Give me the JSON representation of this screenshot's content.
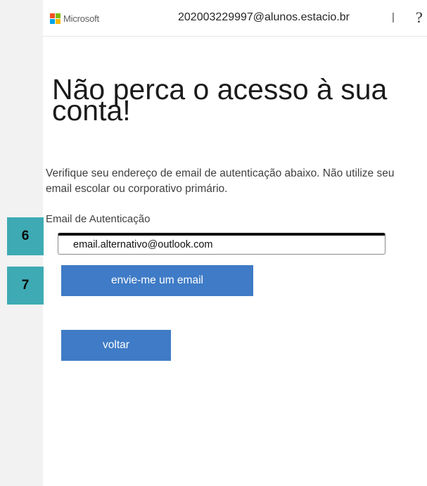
{
  "brand": {
    "name": "Microsoft",
    "colors": [
      "#f25022",
      "#7fba00",
      "#00a4ef",
      "#ffb900"
    ]
  },
  "header": {
    "account_email": "202003229997@alunos.estacio.br",
    "separator": "|",
    "help_symbol": "?"
  },
  "main": {
    "title": "Não perca o acesso à sua conta!",
    "description": "Verifique seu endereço de email de autenticação abaixo. Não utilize seu email escolar ou corporativo primário.",
    "field_label": "Email de Autenticação",
    "email_value": "email.alternativo@outlook.com",
    "send_button": "envie-me um email",
    "back_button": "voltar"
  },
  "annotations": {
    "step_6": "6",
    "step_7": "7"
  },
  "colors": {
    "button": "#3f7bc6",
    "badge": "#3eaab4"
  }
}
